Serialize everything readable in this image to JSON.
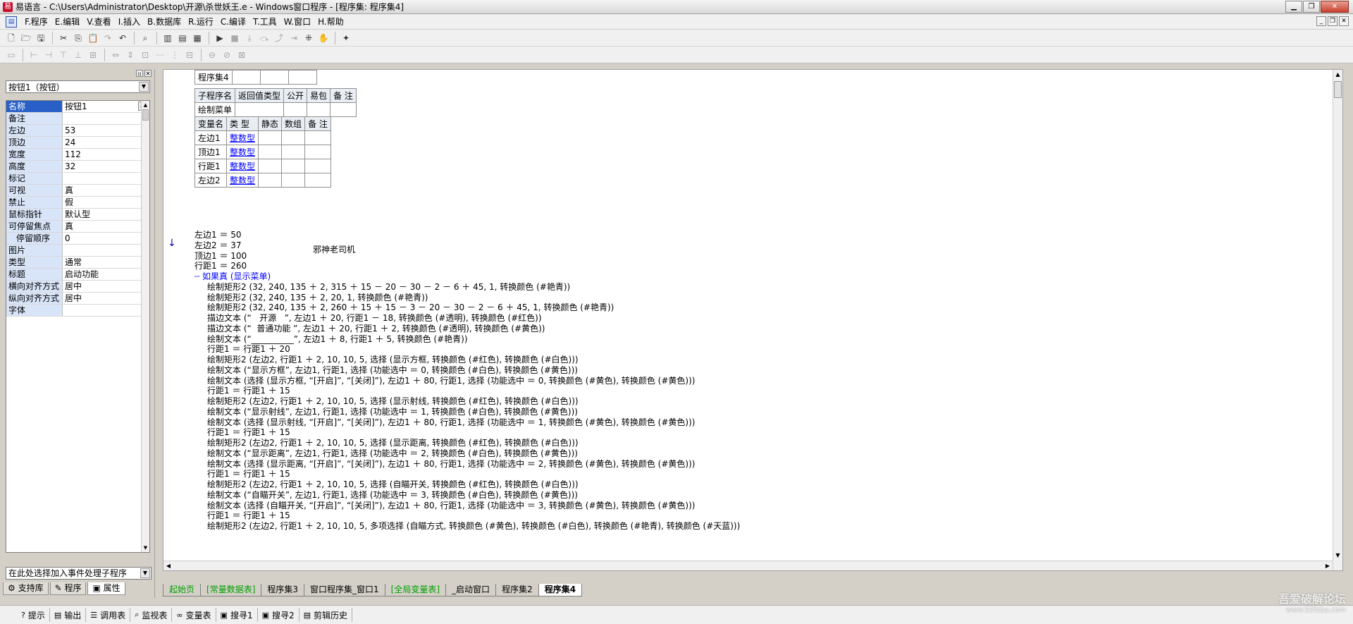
{
  "window": {
    "title": "易语言 - C:\\Users\\Administrator\\Desktop\\开源\\杀世妖王.e - Windows窗口程序 - [程序集: 程序集4]",
    "app_icon_text": "易"
  },
  "menu": [
    "F.程序",
    "E.编辑",
    "V.查看",
    "I.插入",
    "B.数据库",
    "R.运行",
    "C.编译",
    "T.工具",
    "W.窗口",
    "H.帮助"
  ],
  "toolbar1": [
    "新建",
    "打开",
    "保存",
    "剪切",
    "复制",
    "粘贴",
    "重做",
    "撤消",
    "查找",
    "窗口1",
    "窗口2",
    "窗口3",
    "运行",
    "停止",
    "单步",
    "跟踪",
    "跳出",
    "断点",
    "执行到",
    "手型",
    "工具"
  ],
  "left_panel": {
    "object_selector": "按钮1（按钮）",
    "properties": [
      {
        "name": "名称",
        "value": "按钮1",
        "selected": true,
        "has_button": true
      },
      {
        "name": "备注",
        "value": ""
      },
      {
        "name": "左边",
        "value": "53"
      },
      {
        "name": "顶边",
        "value": "24"
      },
      {
        "name": "宽度",
        "value": "112"
      },
      {
        "name": "高度",
        "value": "32"
      },
      {
        "name": "标记",
        "value": ""
      },
      {
        "name": "可视",
        "value": "真"
      },
      {
        "name": "禁止",
        "value": "假"
      },
      {
        "name": "鼠标指针",
        "value": "默认型"
      },
      {
        "name": "可停留焦点",
        "value": "真"
      },
      {
        "name": "停留顺序",
        "value": "0",
        "indent": true
      },
      {
        "name": "图片",
        "value": ""
      },
      {
        "name": "类型",
        "value": "通常"
      },
      {
        "name": "标题",
        "value": "启动功能"
      },
      {
        "name": "横向对齐方式",
        "value": "居中"
      },
      {
        "name": "纵向对齐方式",
        "value": "居中"
      },
      {
        "name": "字体",
        "value": ""
      }
    ],
    "event_selector": "在此处选择加入事件处理子程序",
    "tabs": [
      "支持库",
      "程序",
      "属性"
    ]
  },
  "editor": {
    "assembly_table": [
      [
        "程序集4",
        "",
        "",
        ""
      ]
    ],
    "sub_header": [
      "子程序名",
      "返回值类型",
      "公开",
      "易包",
      "备 注"
    ],
    "sub_row": [
      "绘制菜单",
      "",
      "",
      "",
      ""
    ],
    "var_header": [
      "变量名",
      "类 型",
      "静态",
      "数组",
      "备 注"
    ],
    "var_rows": [
      [
        "左边1",
        "整数型",
        "",
        "",
        ""
      ],
      [
        "顶边1",
        "整数型",
        "",
        "",
        ""
      ],
      [
        "行距1",
        "整数型",
        "",
        "",
        ""
      ],
      [
        "左边2",
        "整数型",
        "",
        "",
        ""
      ]
    ],
    "tip_text": "邪神老司机",
    "lines": [
      {
        "indent": 0,
        "text": "左边1 ＝ 50"
      },
      {
        "indent": 0,
        "text": "左边2 ＝ 37"
      },
      {
        "indent": 0,
        "text": "顶边1 ＝ 100"
      },
      {
        "indent": 0,
        "text": "行距1 ＝ 260"
      },
      {
        "indent": 1,
        "text": "如果真 (显示菜单)",
        "cls": "if"
      },
      {
        "indent": 2,
        "text": "绘制矩形2 (32, 240, 135 ＋ 2, 315 ＋ 15 － 20 － 30 － 2 － 6 ＋ 45, 1, 转换颜色 (#艳青))"
      },
      {
        "indent": 2,
        "text": "绘制矩形2 (32, 240, 135 ＋ 2, 20, 1, 转换颜色 (#艳青))"
      },
      {
        "indent": 2,
        "text": "绘制矩形2 (32, 240, 135 ＋ 2, 260 ＋ 15 ＋ 15 － 3 － 20 － 30 － 2 － 6 ＋ 45, 1, 转换颜色 (#艳青))"
      },
      {
        "indent": 2,
        "text": "描边文本 (“   开源   ”, 左边1 ＋ 20, 行距1 － 18, 转换颜色 (#透明), 转换颜色 (#红色))"
      },
      {
        "indent": 2,
        "text": "描边文本 (“  普通功能 ”, 左边1 ＋ 20, 行距1 ＋ 2, 转换颜色 (#透明), 转换颜色 (#黄色))"
      },
      {
        "indent": 2,
        "text": "绘制文本 (“__________”, 左边1 ＋ 8, 行距1 ＋ 5, 转换颜色 (#艳青))"
      },
      {
        "indent": 2,
        "text": "行距1 ＝ 行距1 ＋ 20"
      },
      {
        "indent": 2,
        "text": "绘制矩形2 (左边2, 行距1 ＋ 2, 10, 10, 5, 选择 (显示方框, 转换颜色 (#红色), 转换颜色 (#白色)))"
      },
      {
        "indent": 2,
        "text": "绘制文本 (“显示方框”, 左边1, 行距1, 选择 (功能选中 ＝ 0, 转换颜色 (#白色), 转换颜色 (#黄色)))"
      },
      {
        "indent": 2,
        "text": "绘制文本 (选择 (显示方框, “[开启]”, “[关闭]”), 左边1 ＋ 80, 行距1, 选择 (功能选中 ＝ 0, 转换颜色 (#黄色), 转换颜色 (#黄色)))"
      },
      {
        "indent": 2,
        "text": "行距1 ＝ 行距1 ＋ 15"
      },
      {
        "indent": 2,
        "text": "绘制矩形2 (左边2, 行距1 ＋ 2, 10, 10, 5, 选择 (显示射线, 转换颜色 (#红色), 转换颜色 (#白色)))"
      },
      {
        "indent": 2,
        "text": "绘制文本 (“显示射线”, 左边1, 行距1, 选择 (功能选中 ＝ 1, 转换颜色 (#白色), 转换颜色 (#黄色)))"
      },
      {
        "indent": 2,
        "text": "绘制文本 (选择 (显示射线, “[开启]”, “[关闭]”), 左边1 ＋ 80, 行距1, 选择 (功能选中 ＝ 1, 转换颜色 (#黄色), 转换颜色 (#黄色)))"
      },
      {
        "indent": 2,
        "text": "行距1 ＝ 行距1 ＋ 15"
      },
      {
        "indent": 2,
        "text": "绘制矩形2 (左边2, 行距1 ＋ 2, 10, 10, 5, 选择 (显示距离, 转换颜色 (#红色), 转换颜色 (#白色)))"
      },
      {
        "indent": 2,
        "text": "绘制文本 (“显示距离”, 左边1, 行距1, 选择 (功能选中 ＝ 2, 转换颜色 (#白色), 转换颜色 (#黄色)))"
      },
      {
        "indent": 2,
        "text": "绘制文本 (选择 (显示距离, “[开启]”, “[关闭]”), 左边1 ＋ 80, 行距1, 选择 (功能选中 ＝ 2, 转换颜色 (#黄色), 转换颜色 (#黄色)))"
      },
      {
        "indent": 2,
        "text": "行距1 ＝ 行距1 ＋ 15"
      },
      {
        "indent": 2,
        "text": "绘制矩形2 (左边2, 行距1 ＋ 2, 10, 10, 5, 选择 (自瞄开关, 转换颜色 (#红色), 转换颜色 (#白色)))"
      },
      {
        "indent": 2,
        "text": "绘制文本 (“自瞄开关”, 左边1, 行距1, 选择 (功能选中 ＝ 3, 转换颜色 (#白色), 转换颜色 (#黄色)))"
      },
      {
        "indent": 2,
        "text": "绘制文本 (选择 (自瞄开关, “[开启]”, “[关闭]”), 左边1 ＋ 80, 行距1, 选择 (功能选中 ＝ 3, 转换颜色 (#黄色), 转换颜色 (#黄色)))"
      },
      {
        "indent": 2,
        "text": "行距1 ＝ 行距1 ＋ 15"
      },
      {
        "indent": 2,
        "text": "绘制矩形2 (左边2, 行距1 ＋ 2, 10, 10, 5, 多项选择 (自瞄方式, 转换颜色 (#黄色), 转换颜色 (#白色), 转换颜色 (#艳青), 转换颜色 (#天蓝)))"
      }
    ]
  },
  "doc_tabs": [
    {
      "label": "起始页",
      "style": "green"
    },
    {
      "label": "[常量数据表]",
      "style": "green"
    },
    {
      "label": "程序集3",
      "style": ""
    },
    {
      "label": "窗口程序集_窗口1",
      "style": ""
    },
    {
      "label": "[全局变量表]",
      "style": "green"
    },
    {
      "label": "_启动窗口",
      "style": ""
    },
    {
      "label": "程序集2",
      "style": ""
    },
    {
      "label": "程序集4",
      "style": "active"
    }
  ],
  "bottom_tabs": [
    {
      "icon": "?",
      "label": "提示"
    },
    {
      "icon": "▤",
      "label": "输出"
    },
    {
      "icon": "☰",
      "label": "调用表"
    },
    {
      "icon": "⌕",
      "label": "监视表"
    },
    {
      "icon": "∞",
      "label": "变量表"
    },
    {
      "icon": "▣",
      "label": "搜寻1"
    },
    {
      "icon": "▣",
      "label": "搜寻2"
    },
    {
      "icon": "▤",
      "label": "剪辑历史"
    }
  ],
  "watermark": {
    "main": "吾爱破解论坛",
    "url": "www.52fzba.com"
  }
}
